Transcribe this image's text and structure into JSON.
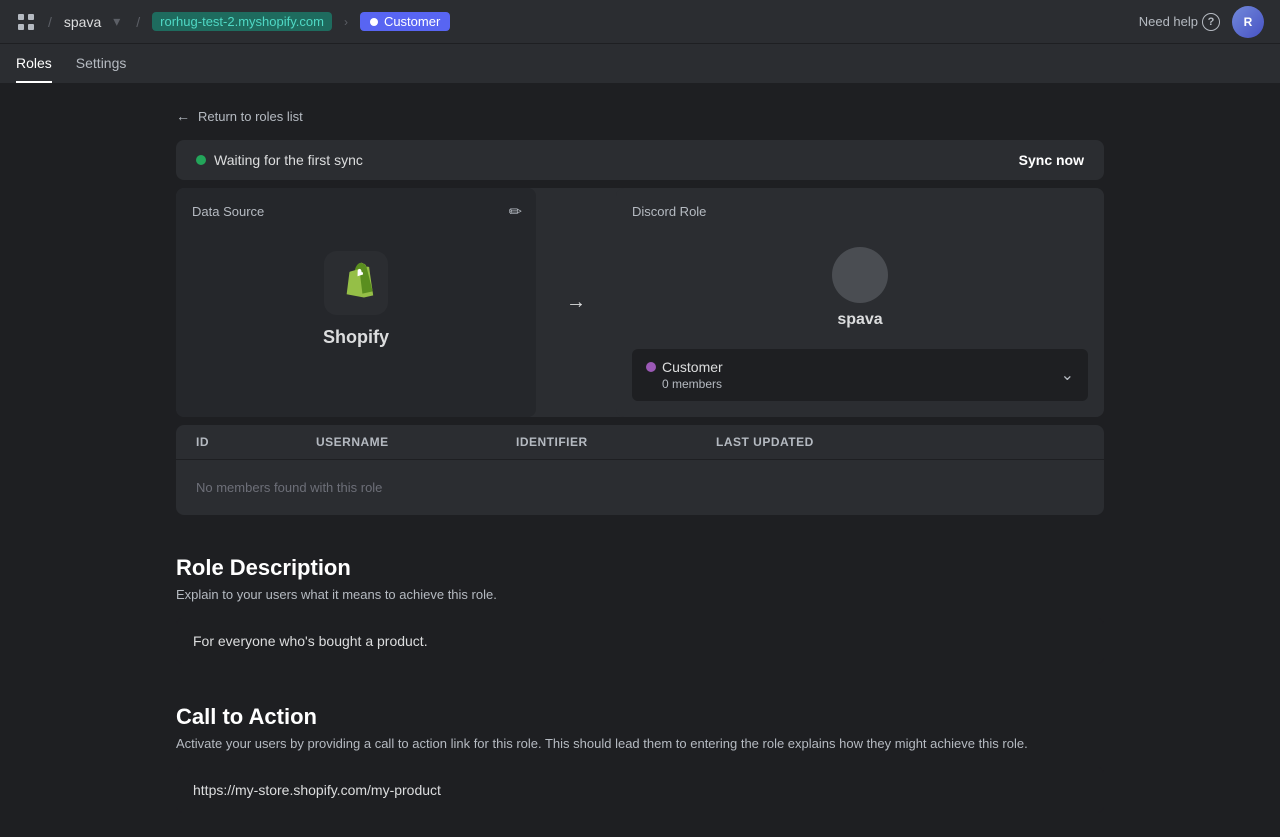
{
  "topbar": {
    "grid_icon": "⊞",
    "workspace": "spava",
    "breadcrumb_link": "rorhug-test-2.myshopify.com",
    "breadcrumb_current": "Customer",
    "need_help_label": "Need help",
    "avatar_initials": "R"
  },
  "secondary_nav": {
    "tabs": [
      {
        "label": "Roles",
        "active": true
      },
      {
        "label": "Settings",
        "active": false
      }
    ]
  },
  "back_link": "Return to roles list",
  "sync_bar": {
    "status_text": "Waiting for the first sync",
    "sync_button": "Sync now"
  },
  "data_source_card": {
    "title": "Data Source",
    "source_label": "Shopify"
  },
  "discord_role_card": {
    "title": "Discord Role",
    "server_name": "spava",
    "role_name": "Customer",
    "role_members": "0 members"
  },
  "table": {
    "columns": [
      "ID",
      "Username",
      "Identifier",
      "Last updated"
    ],
    "empty_message": "No members found with this role"
  },
  "role_description": {
    "section_title": "Role Description",
    "section_desc": "Explain to your users what it means to achieve this role.",
    "value": "For everyone who's bought a product."
  },
  "call_to_action": {
    "section_title": "Call to Action",
    "section_desc": "Activate your users by providing a call to action link for this role. This should lead them to entering the role explains how they might achieve this role.",
    "value": "https://my-store.shopify.com/my-product"
  }
}
